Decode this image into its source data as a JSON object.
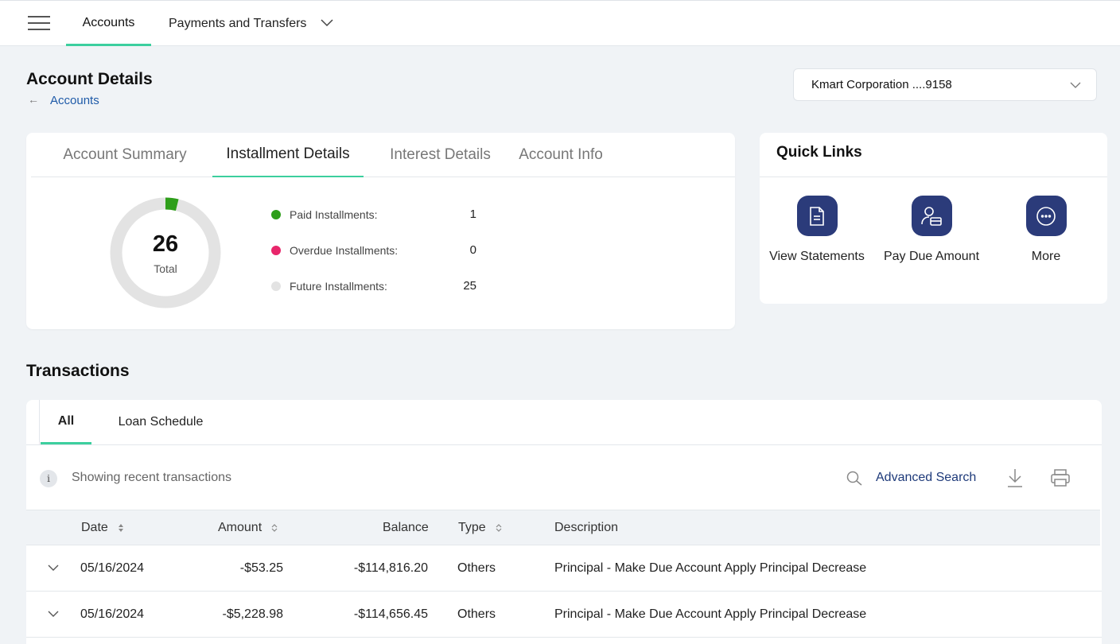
{
  "nav": {
    "tabs": [
      {
        "label": "Accounts"
      },
      {
        "label": "Payments and Transfers"
      }
    ]
  },
  "header": {
    "title": "Account Details",
    "breadcrumb": "Accounts",
    "account_selector": "Kmart Corporation ....9158"
  },
  "installments": {
    "tabs": [
      "Account Summary",
      "Installment Details",
      "Interest Details",
      "Account Info"
    ],
    "active_tab": "Installment Details",
    "total": "26",
    "total_label": "Total",
    "legend": [
      {
        "label": "Paid Installments:",
        "value": "1",
        "color": "#2e9e1a"
      },
      {
        "label": "Overdue Installments:",
        "value": "0",
        "color": "#e8266b"
      },
      {
        "label": "Future Installments:",
        "value": "25",
        "color": "#e3e3e3"
      }
    ]
  },
  "quick_links": {
    "title": "Quick Links",
    "items": [
      {
        "label": "View Statements",
        "icon": "document-icon"
      },
      {
        "label": "Pay Due Amount",
        "icon": "user-card-icon"
      },
      {
        "label": "More",
        "icon": "more-icon"
      }
    ]
  },
  "transactions": {
    "title": "Transactions",
    "tabs": [
      "All",
      "Loan Schedule"
    ],
    "active_tab": "All",
    "info": "Showing recent transactions",
    "advanced_search": "Advanced Search",
    "columns": [
      "Date",
      "Amount",
      "Balance",
      "Type",
      "Description"
    ],
    "rows": [
      {
        "date": "05/16/2024",
        "amount": "-$53.25",
        "balance": "-$114,816.20",
        "type": "Others",
        "description": "Principal - Make Due Account Apply Principal Decrease"
      },
      {
        "date": "05/16/2024",
        "amount": "-$5,228.98",
        "balance": "-$114,656.45",
        "type": "Others",
        "description": "Principal - Make Due Account Apply Principal Decrease"
      }
    ]
  },
  "colors": {
    "accent": "#3ccf9e",
    "primary": "#2b3b7a",
    "link": "#1e5aa8"
  }
}
